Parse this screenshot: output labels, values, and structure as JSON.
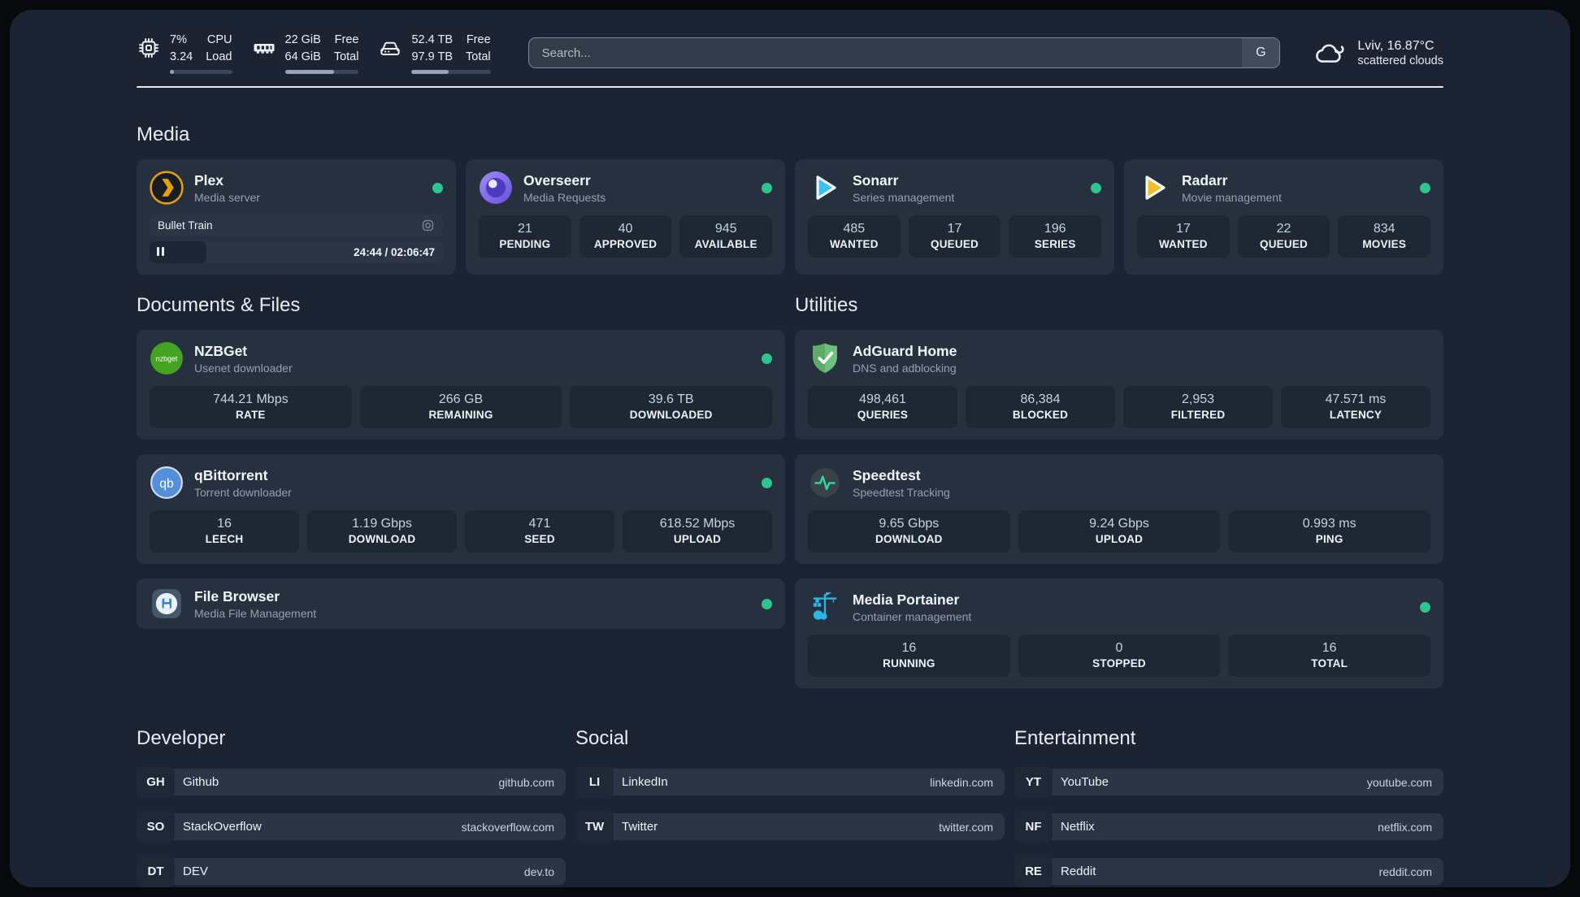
{
  "colors": {
    "background": "#1c2433",
    "card": "#27303f",
    "tile": "#1e2734",
    "status_online": "#2ec48d",
    "plex_orange": "#e5a00d",
    "sonarr_blue": "#35c5f4",
    "radarr_yellow": "#f3bd25",
    "nzbget_green": "#43a422",
    "qbittorrent_blue": "#548fd9",
    "adguard_green": "#67b979",
    "speedtest_green": "#2fd5a3",
    "portainer_cyan": "#29b8e5",
    "overseerr_purple": "#7c63e8"
  },
  "header": {
    "stats": {
      "cpu": {
        "value_top": "7%",
        "value_bottom": "3.24",
        "label_top": "CPU",
        "label_bottom": "Load",
        "progress_pct": 7
      },
      "memory": {
        "value_top": "22 GiB",
        "value_bottom": "64 GiB",
        "label_top": "Free",
        "label_bottom": "Total",
        "progress_pct": 66
      },
      "disk": {
        "value_top": "52.4 TB",
        "value_bottom": "97.9 TB",
        "label_top": "Free",
        "label_bottom": "Total",
        "progress_pct": 47
      }
    },
    "search": {
      "placeholder": "Search...",
      "engine_label": "G"
    },
    "weather": {
      "location_temp": "Lviv, 16.87°C",
      "condition": "scattered clouds"
    }
  },
  "sections": {
    "media": {
      "title": "Media",
      "cards": [
        {
          "name": "Plex",
          "subtitle": "Media server",
          "online": true,
          "player": {
            "track": "Bullet Train",
            "time_display": "24:44 / 02:06:47",
            "progress_pct": 19.5
          }
        },
        {
          "name": "Overseerr",
          "subtitle": "Media Requests",
          "online": true,
          "stats": [
            {
              "value": "21",
              "label": "PENDING"
            },
            {
              "value": "40",
              "label": "APPROVED"
            },
            {
              "value": "945",
              "label": "AVAILABLE"
            }
          ]
        },
        {
          "name": "Sonarr",
          "subtitle": "Series management",
          "online": true,
          "stats": [
            {
              "value": "485",
              "label": "WANTED"
            },
            {
              "value": "17",
              "label": "QUEUED"
            },
            {
              "value": "196",
              "label": "SERIES"
            }
          ]
        },
        {
          "name": "Radarr",
          "subtitle": "Movie management",
          "online": true,
          "stats": [
            {
              "value": "17",
              "label": "WANTED"
            },
            {
              "value": "22",
              "label": "QUEUED"
            },
            {
              "value": "834",
              "label": "MOVIES"
            }
          ]
        }
      ]
    },
    "documents": {
      "title": "Documents & Files",
      "cards": [
        {
          "name": "NZBGet",
          "subtitle": "Usenet downloader",
          "online": true,
          "stats": [
            {
              "value": "744.21 Mbps",
              "label": "RATE"
            },
            {
              "value": "266 GB",
              "label": "REMAINING"
            },
            {
              "value": "39.6 TB",
              "label": "DOWNLOADED"
            }
          ]
        },
        {
          "name": "qBittorrent",
          "subtitle": "Torrent downloader",
          "online": true,
          "stats": [
            {
              "value": "16",
              "label": "LEECH"
            },
            {
              "value": "1.19 Gbps",
              "label": "DOWNLOAD"
            },
            {
              "value": "471",
              "label": "SEED"
            },
            {
              "value": "618.52 Mbps",
              "label": "UPLOAD"
            }
          ]
        },
        {
          "name": "File Browser",
          "subtitle": "Media File Management",
          "online": true,
          "stats": []
        }
      ]
    },
    "utilities": {
      "title": "Utilities",
      "cards": [
        {
          "name": "AdGuard Home",
          "subtitle": "DNS and adblocking",
          "stats": [
            {
              "value": "498,461",
              "label": "QUERIES"
            },
            {
              "value": "86,384",
              "label": "BLOCKED"
            },
            {
              "value": "2,953",
              "label": "FILTERED"
            },
            {
              "value": "47.571 ms",
              "label": "LATENCY"
            }
          ]
        },
        {
          "name": "Speedtest",
          "subtitle": "Speedtest Tracking",
          "stats": [
            {
              "value": "9.65 Gbps",
              "label": "DOWNLOAD"
            },
            {
              "value": "9.24 Gbps",
              "label": "UPLOAD"
            },
            {
              "value": "0.993 ms",
              "label": "PING"
            }
          ]
        },
        {
          "name": "Media Portainer",
          "subtitle": "Container management",
          "online": true,
          "stats": [
            {
              "value": "16",
              "label": "RUNNING"
            },
            {
              "value": "0",
              "label": "STOPPED"
            },
            {
              "value": "16",
              "label": "TOTAL"
            }
          ]
        }
      ]
    },
    "bookmarks": [
      {
        "title": "Developer",
        "links": [
          {
            "tag": "GH",
            "name": "Github",
            "url": "github.com"
          },
          {
            "tag": "SO",
            "name": "StackOverflow",
            "url": "stackoverflow.com"
          },
          {
            "tag": "DT",
            "name": "DEV",
            "url": "dev.to"
          }
        ]
      },
      {
        "title": "Social",
        "links": [
          {
            "tag": "LI",
            "name": "LinkedIn",
            "url": "linkedin.com"
          },
          {
            "tag": "TW",
            "name": "Twitter",
            "url": "twitter.com"
          }
        ]
      },
      {
        "title": "Entertainment",
        "links": [
          {
            "tag": "YT",
            "name": "YouTube",
            "url": "youtube.com"
          },
          {
            "tag": "NF",
            "name": "Netflix",
            "url": "netflix.com"
          },
          {
            "tag": "RE",
            "name": "Reddit",
            "url": "reddit.com"
          }
        ]
      }
    ]
  }
}
